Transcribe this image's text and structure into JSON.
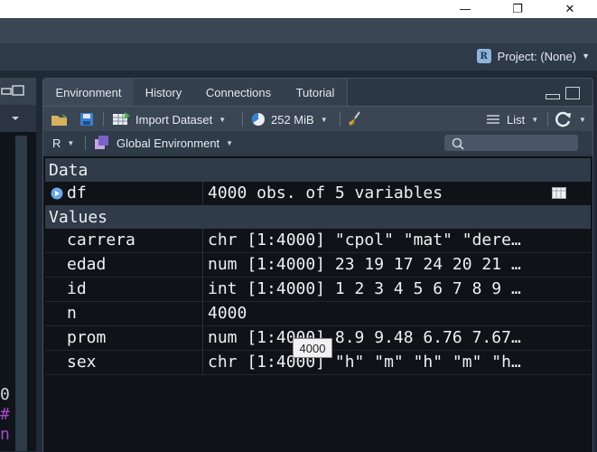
{
  "window": {
    "minimize_glyph": "—",
    "restore_glyph": "❐",
    "close_glyph": "✕"
  },
  "project": {
    "label": "Project: (None)",
    "icon": "r-project-icon"
  },
  "tabs": [
    {
      "label": "Environment",
      "active": true
    },
    {
      "label": "History"
    },
    {
      "label": "Connections"
    },
    {
      "label": "Tutorial"
    }
  ],
  "toolbar": {
    "import_label": "Import Dataset",
    "memory_label": "252 MiB",
    "view_label": "List"
  },
  "envbar": {
    "language": "R",
    "scope": "Global Environment",
    "search_placeholder": ""
  },
  "sections": {
    "data": "Data",
    "values": "Values"
  },
  "data_rows": [
    {
      "name": "df",
      "value": "4000 obs. of 5 variables"
    }
  ],
  "value_rows": [
    {
      "name": "carrera",
      "value": "chr [1:4000] \"cpol\" \"mat\" \"dere…"
    },
    {
      "name": "edad",
      "value": "num [1:4000] 23 19 17 24 20 21 …"
    },
    {
      "name": "id",
      "value": "int [1:4000] 1 2 3 4 5 6 7 8 9 …"
    },
    {
      "name": "n",
      "value": "4000"
    },
    {
      "name": "prom",
      "value": "num [1:4000] 8.9 9.48 6.76 7.67…"
    },
    {
      "name": "sex",
      "value": "chr [1:4000] \"h\" \"m\" \"h\" \"m\" \"h…"
    }
  ],
  "tooltip": "4000",
  "left_code_glyphs": [
    "0",
    "#",
    "n"
  ],
  "colors": {
    "accent_blue": "#6aa7e8",
    "broom": "#d9a441",
    "purple": "#a64ac9"
  }
}
